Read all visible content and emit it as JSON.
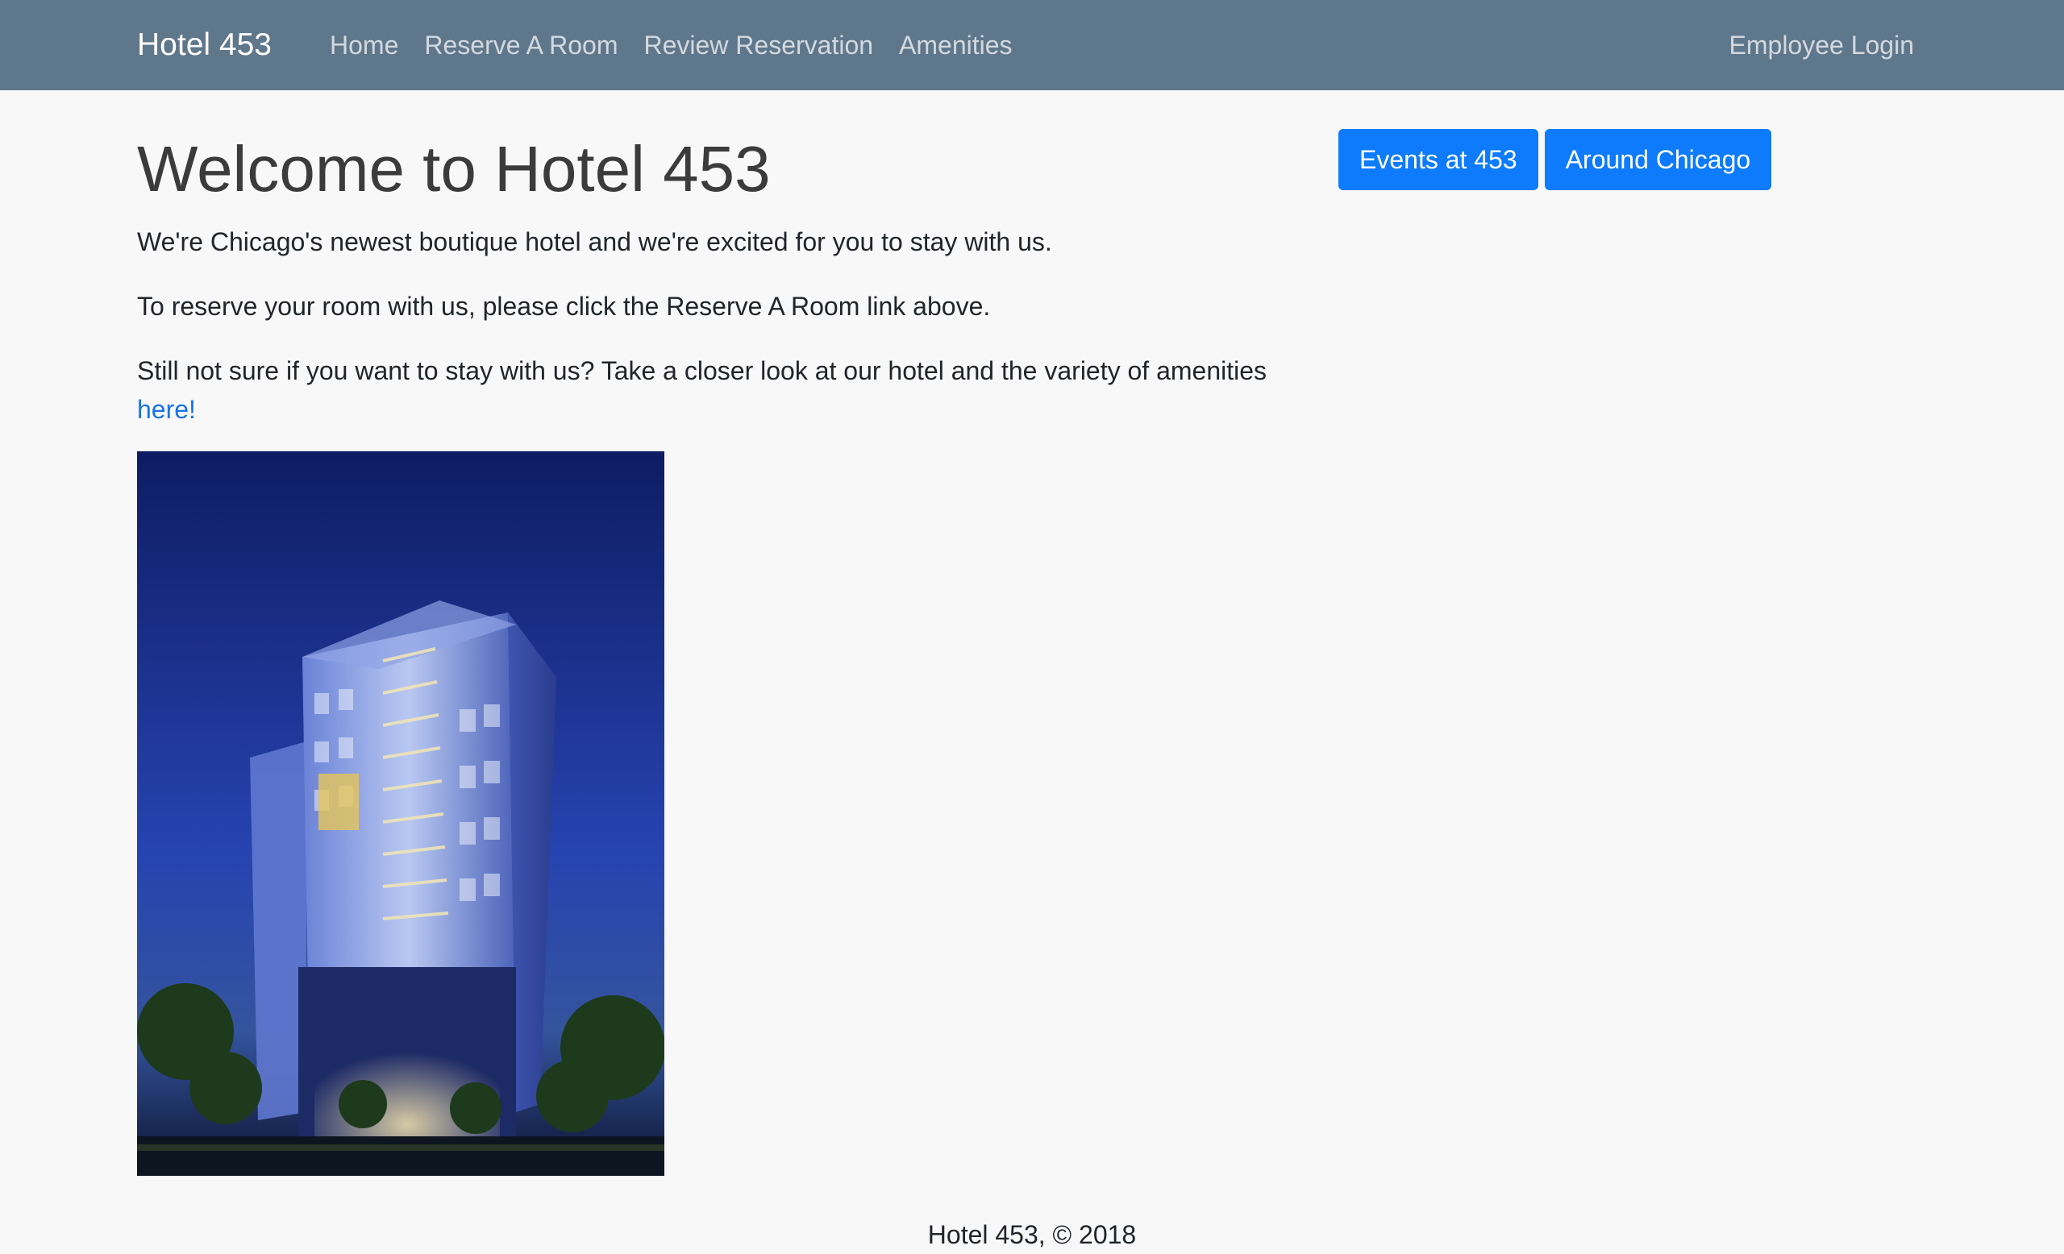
{
  "navbar": {
    "brand": "Hotel 453",
    "links": [
      {
        "label": "Home"
      },
      {
        "label": "Reserve A Room"
      },
      {
        "label": "Review Reservation"
      },
      {
        "label": "Amenities"
      }
    ],
    "right_link": "Employee Login",
    "background_color": "#5f778b"
  },
  "main": {
    "title": "Welcome to Hotel 453",
    "paragraphs": [
      "We're Chicago's newest boutique hotel and we're excited for you to stay with us.",
      "To reserve your room with us, please click the Reserve A Room link above."
    ],
    "closer_look_text": "Still not sure if you want to stay with us? Take a closer look at our hotel and the variety of amenities",
    "here_link": "here!",
    "image": {
      "semantic": "hotel-building-photo"
    }
  },
  "side_buttons": {
    "events": "Events at 453",
    "around": "Around Chicago",
    "color": "#0d7bfb"
  },
  "footer": {
    "text": "Hotel 453, © 2018"
  }
}
